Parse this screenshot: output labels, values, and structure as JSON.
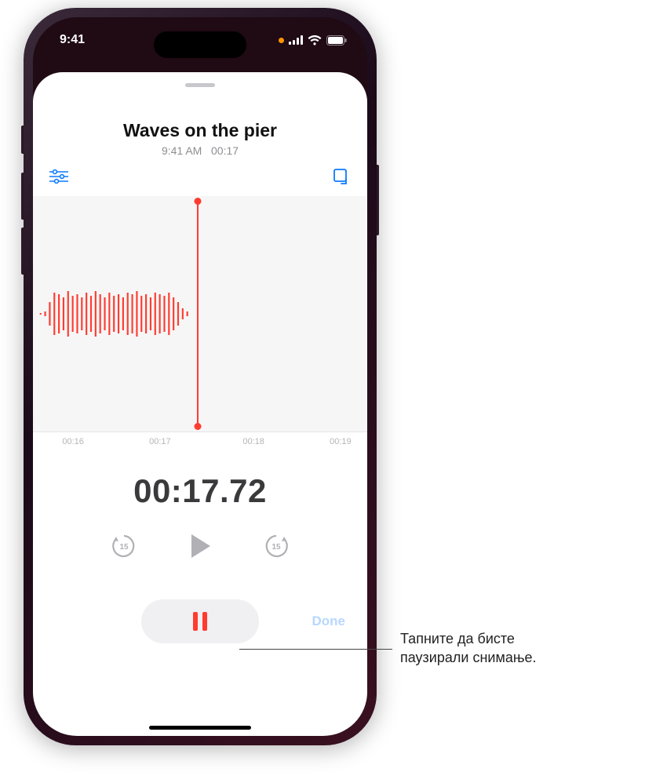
{
  "status": {
    "time": "9:41"
  },
  "recording": {
    "title": "Waves on the pier",
    "meta_time": "9:41 AM",
    "meta_duration": "00:17"
  },
  "ruler": {
    "t0": "00:16",
    "t1": "00:17",
    "t2": "00:18",
    "t3": "00:19"
  },
  "elapsed": "00:17.72",
  "skip_back_label": "15",
  "skip_fwd_label": "15",
  "done_label": "Done",
  "callout": {
    "line1": "Тапните да бисте",
    "line2": "паузирали снимање."
  },
  "colors": {
    "accent_red": "#ff3b30",
    "ios_blue": "#0a7aff"
  }
}
